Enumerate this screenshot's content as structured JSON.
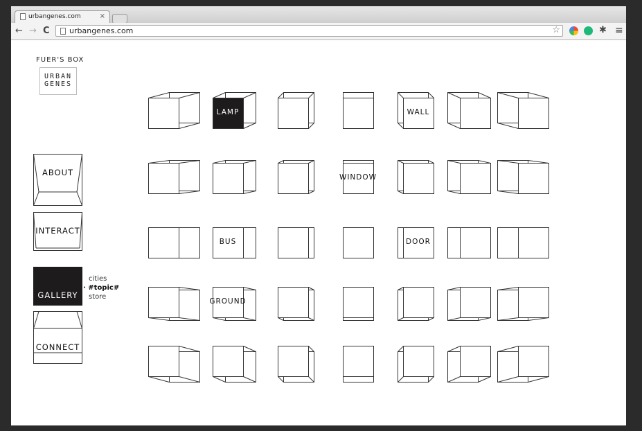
{
  "browser": {
    "tab_title": "urbangenes.com",
    "tab_close": "×",
    "back": "←",
    "forward": "→",
    "reload": "C",
    "url": "urbangenes.com",
    "star": "☆",
    "puzzle": "✱",
    "menu": "≡"
  },
  "brand": {
    "title": "FUER'S BOX",
    "logo_line1": "URBAN",
    "logo_line2": "GENES"
  },
  "nav": {
    "about": "ABOUT",
    "interact": "INTERACT",
    "gallery": "GALLERY",
    "connect": "CONNECT"
  },
  "submenu": {
    "item1": "cities",
    "item2": "· #topic#",
    "item3": "store"
  },
  "grid": {
    "lamp": "LAMP",
    "wall": "WALL",
    "window": "WINDOW",
    "bus": "BUS",
    "door": "DOOR",
    "ground": "GROUND"
  },
  "colors": {
    "dark": "#1e1b1c",
    "line": "#333333"
  }
}
